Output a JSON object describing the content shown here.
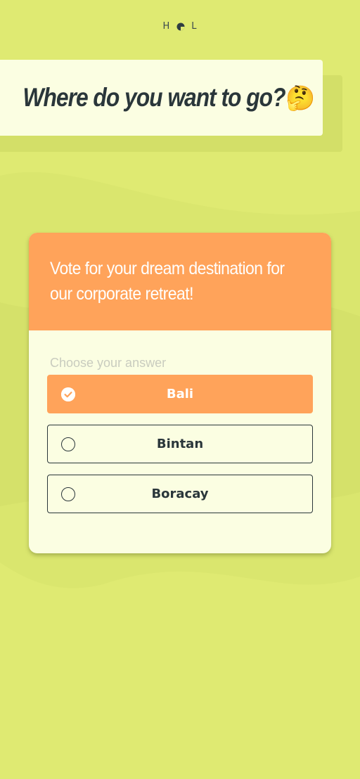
{
  "brand": {
    "logo_left": "H",
    "logo_right": "L",
    "logo_icon": "hol-logo-dot-icon"
  },
  "title": {
    "text": "Where do you want to go?",
    "emoji": "🤔"
  },
  "poll": {
    "question": "Vote for your dream destination for our corporate retreat!",
    "choose_label": "Choose your answer",
    "options": [
      {
        "label": "Bali",
        "selected": true
      },
      {
        "label": "Bintan",
        "selected": false
      },
      {
        "label": "Boracay",
        "selected": false
      }
    ]
  },
  "colors": {
    "background": "#dfea72",
    "card": "#fbfee2",
    "accent": "#ffa35a",
    "text_dark": "#2a363a",
    "muted": "#c9ccbf"
  }
}
